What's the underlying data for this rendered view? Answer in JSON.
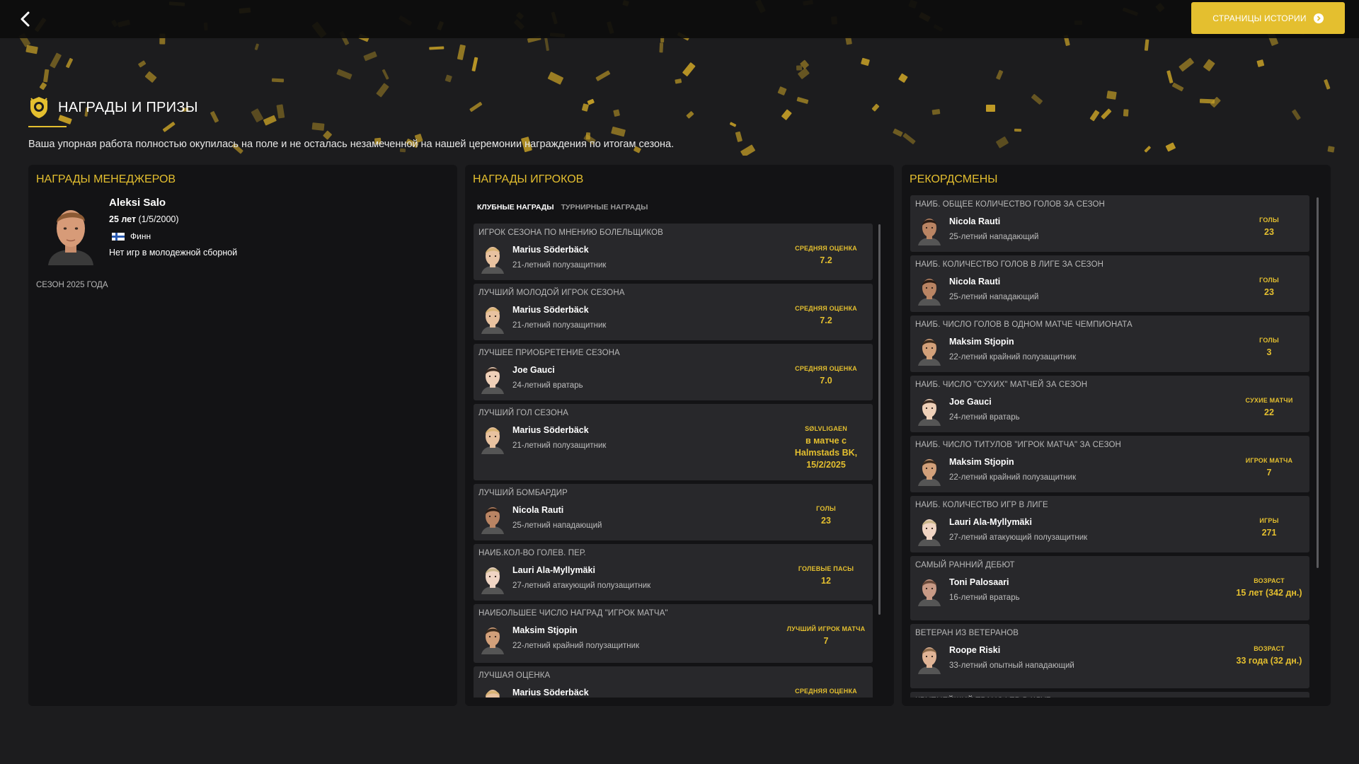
{
  "topbar": {
    "story_button": "СТРАНИЦЫ ИСТОРИИ"
  },
  "page": {
    "title": "НАГРАДЫ И ПРИЗЫ",
    "intro": "Ваша упорная работа полностью окупилась на поле и не осталась незамеченной на нашей церемонии награждения по итогам сезона."
  },
  "managers": {
    "title": "НАГРАДЫ МЕНЕДЖЕРОВ",
    "name": "Aleksi Salo",
    "age": "25 лет",
    "dob": "(1/5/2000)",
    "nationality": "Финн",
    "youth": "Нет игр в молодежной сборной",
    "season": "СЕЗОН 2025 ГОДА"
  },
  "players": {
    "title": "НАГРАДЫ ИГРОКОВ",
    "tabs": [
      "КЛУБНЫЕ НАГРАДЫ",
      "ТУРНИРНЫЕ НАГРАДЫ"
    ],
    "cards": [
      {
        "title": "ИГРОК СЕЗОНА ПО МНЕНИЮ БОЛЕЛЬЩИКОВ",
        "name": "Marius Söderbäck",
        "desc": "21-летний полузащитник",
        "stat_label": "СРЕДНЯЯ ОЦЕНКА",
        "stat_value": "7.2"
      },
      {
        "title": "ЛУЧШИЙ МОЛОДОЙ ИГРОК СЕЗОНА",
        "name": "Marius Söderbäck",
        "desc": "21-летний полузащитник",
        "stat_label": "СРЕДНЯЯ ОЦЕНКА",
        "stat_value": "7.2"
      },
      {
        "title": "ЛУЧШЕЕ ПРИОБРЕТЕНИЕ СЕЗОНА",
        "name": "Joe Gauci",
        "desc": "24-летний вратарь",
        "stat_label": "СРЕДНЯЯ ОЦЕНКА",
        "stat_value": "7.0"
      },
      {
        "title": "ЛУЧШИЙ ГОЛ СЕЗОНА",
        "name": "Marius Söderbäck",
        "desc": "21-летний полузащитник",
        "stat_label": "SØLVLIGAEN",
        "stat_value": "в матче с Halmstads BK, 15/2/2025"
      },
      {
        "title": "ЛУЧШИЙ БОМБАРДИР",
        "name": "Nicola Rauti",
        "desc": "25-летний нападающий",
        "stat_label": "ГОЛЫ",
        "stat_value": "23"
      },
      {
        "title": "НАИБ.КОЛ-ВО ГОЛЕВ. ПЕР.",
        "name": "Lauri Ala-Myllymäki",
        "desc": "27-летний атакующий полузащитник",
        "stat_label": "ГОЛЕВЫЕ ПАСЫ",
        "stat_value": "12"
      },
      {
        "title": "НАИБОЛЬШЕЕ ЧИСЛО НАГРАД \"ИГРОК МАТЧА\"",
        "name": "Maksim Stjopin",
        "desc": "22-летний крайний полузащитник",
        "stat_label": "ЛУЧШИЙ ИГРОК МАТЧА",
        "stat_value": "7"
      },
      {
        "title": "ЛУЧШАЯ ОЦЕНКА",
        "name": "Marius Söderbäck",
        "desc": "",
        "stat_label": "СРЕДНЯЯ ОЦЕНКА",
        "stat_value": ""
      }
    ]
  },
  "records": {
    "title": "РЕКОРДСМЕНЫ",
    "cards": [
      {
        "title": "НАИБ. ОБЩЕЕ КОЛИЧЕСТВО ГОЛОВ ЗА СЕЗОН",
        "name": "Nicola Rauti",
        "desc": "25-летний нападающий",
        "stat_label": "ГОЛЫ",
        "stat_value": "23"
      },
      {
        "title": "НАИБ. КОЛИЧЕСТВО ГОЛОВ В ЛИГЕ ЗА СЕЗОН",
        "name": "Nicola Rauti",
        "desc": "25-летний нападающий",
        "stat_label": "ГОЛЫ",
        "stat_value": "23"
      },
      {
        "title": "НАИБ. ЧИСЛО ГОЛОВ В ОДНОМ МАТЧЕ ЧЕМПИОНАТА",
        "name": "Maksim Stjopin",
        "desc": "22-летний крайний полузащитник",
        "stat_label": "ГОЛЫ",
        "stat_value": "3"
      },
      {
        "title": "НАИБ. ЧИСЛО \"СУХИХ\" МАТЧЕЙ ЗА СЕЗОН",
        "name": "Joe Gauci",
        "desc": "24-летний вратарь",
        "stat_label": "СУХИЕ МАТЧИ",
        "stat_value": "22"
      },
      {
        "title": "НАИБ. ЧИСЛО ТИТУЛОВ \"ИГРОК МАТЧА\" ЗА СЕЗОН",
        "name": "Maksim Stjopin",
        "desc": "22-летний крайний полузащитник",
        "stat_label": "ИГРОК МАТЧА",
        "stat_value": "7"
      },
      {
        "title": "НАИБ. КОЛИЧЕСТВО ИГР В ЛИГЕ",
        "name": "Lauri Ala-Myllymäki",
        "desc": "27-летний атакующий полузащитник",
        "stat_label": "ИГРЫ",
        "stat_value": "271"
      },
      {
        "title": "САМЫЙ РАННИЙ ДЕБЮТ",
        "name": "Toni Palosaari",
        "desc": "16-летний вратарь",
        "stat_label": "ВОЗРАСТ",
        "stat_value": "15 лет (342 дн.)"
      },
      {
        "title": "ВЕТЕРАН ИЗ ВЕТЕРАНОВ",
        "name": "Roope Riski",
        "desc": "33-летний опытный нападающий",
        "stat_label": "ВОЗРАСТ",
        "stat_value": "33 года (32 дн.)"
      },
      {
        "title": "КРУПНЕЙШИЙ ТРАНСФЕР В КЛУБ",
        "name": "",
        "desc": "",
        "stat_label": "",
        "stat_value": ""
      }
    ]
  },
  "colors": {
    "accent": "#e4bf2f",
    "panel": "#131315",
    "card": "#28282b",
    "background": "#1c1c1e"
  },
  "icons": [
    "back-chevron-icon",
    "arrow-right-circle-icon",
    "club-crest-icon",
    "finland-flag-icon"
  ]
}
